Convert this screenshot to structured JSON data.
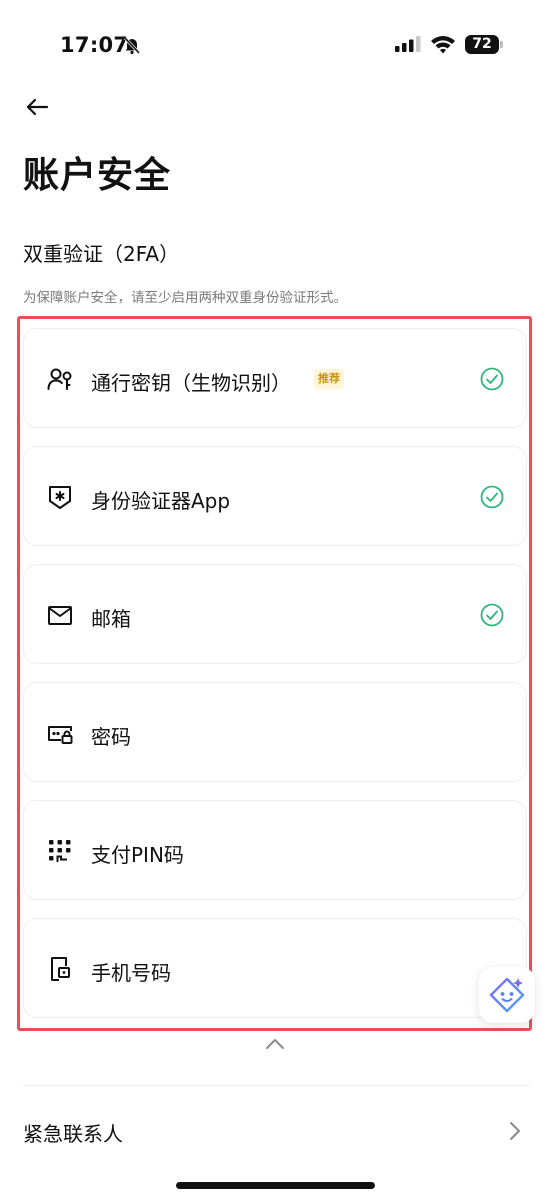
{
  "status_bar": {
    "time": "17:07",
    "battery": "72"
  },
  "page": {
    "title": "账户安全"
  },
  "twofa": {
    "title": "双重验证（2FA）",
    "description": "为保障账户安全，请至少启用两种双重身份验证形式。",
    "items": [
      {
        "label": "通行密钥（生物识别）",
        "badge": "推荐",
        "icon": "passkey-person-icon",
        "enabled": true
      },
      {
        "label": "身份验证器App",
        "icon": "authenticator-shield-icon",
        "enabled": true
      },
      {
        "label": "邮箱",
        "icon": "mail-icon",
        "enabled": true
      },
      {
        "label": "密码",
        "icon": "password-lock-icon",
        "enabled": false
      },
      {
        "label": "支付PIN码",
        "icon": "pin-keypad-icon",
        "enabled": false
      },
      {
        "label": "手机号码",
        "icon": "phone-icon",
        "enabled": false
      }
    ]
  },
  "emergency": {
    "label": "紧急联系人"
  },
  "colors": {
    "check": "#2fb67c",
    "highlight": "#e94f55",
    "badge_bg": "#fff5d6",
    "badge_text": "#c8941a"
  }
}
